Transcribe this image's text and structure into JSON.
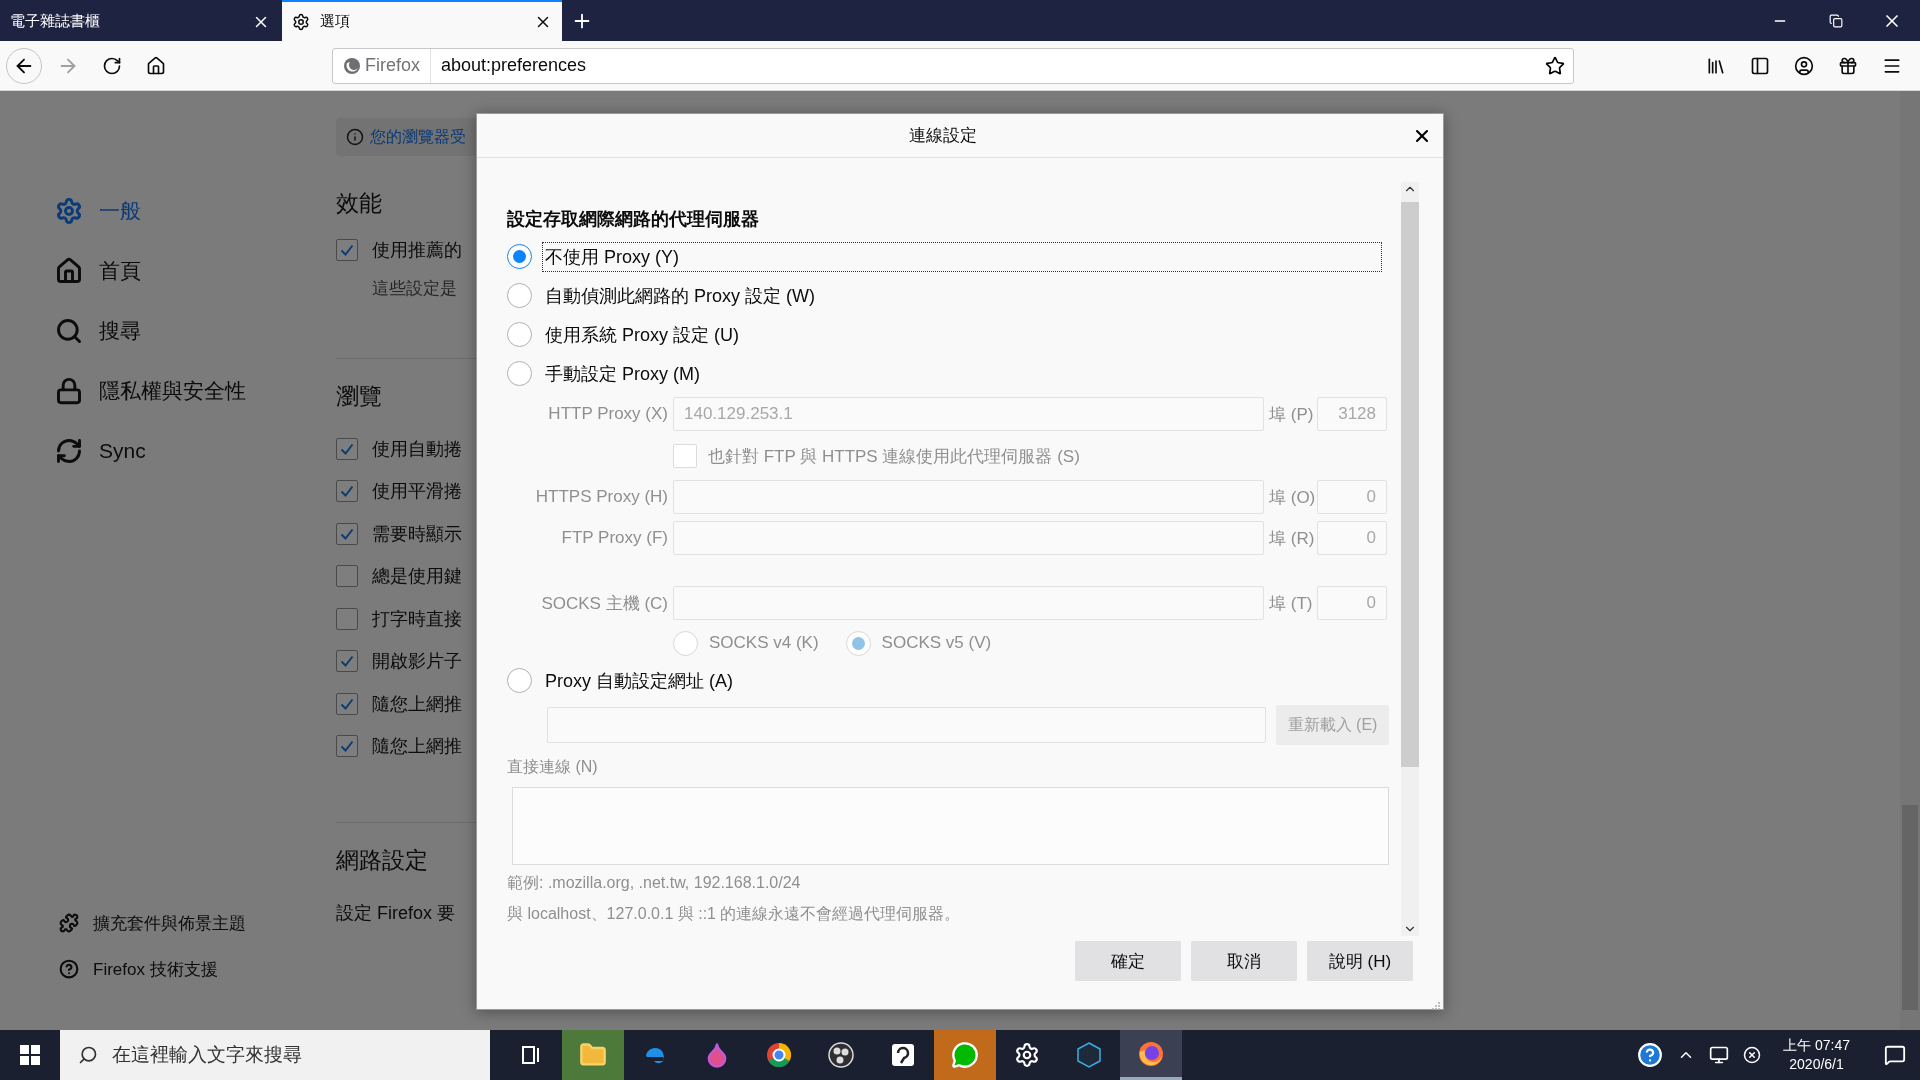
{
  "browser": {
    "tabs": [
      {
        "title": "電子雜誌書櫃",
        "selected": false
      },
      {
        "title": "選項",
        "selected": true
      }
    ],
    "url_bar": {
      "identity": "Firefox",
      "url": "about:preferences"
    }
  },
  "preferences": {
    "notice": "您的瀏覽器受",
    "sidebar": {
      "items": [
        {
          "label": "一般",
          "kind": "general",
          "selected": true
        },
        {
          "label": "首頁",
          "kind": "home",
          "selected": false
        },
        {
          "label": "搜尋",
          "kind": "search",
          "selected": false
        },
        {
          "label": "隱私權與安全性",
          "kind": "privacy",
          "selected": false
        },
        {
          "label": "Sync",
          "kind": "sync",
          "selected": false
        }
      ],
      "footer": [
        {
          "label": "擴充套件與佈景主題",
          "kind": "addons"
        },
        {
          "label": "Firefox 技術支援",
          "kind": "support"
        }
      ]
    },
    "sections": [
      {
        "title": "效能",
        "rows": [
          {
            "kind": "checkbox",
            "label": "使用推薦的",
            "checked": true
          },
          {
            "kind": "note",
            "label": "這些設定是"
          }
        ]
      },
      {
        "title": "瀏覽",
        "rows": [
          {
            "kind": "checkbox",
            "label": "使用自動捲",
            "checked": true
          },
          {
            "kind": "checkbox",
            "label": "使用平滑捲",
            "checked": true
          },
          {
            "kind": "checkbox",
            "label": "需要時顯示",
            "checked": true
          },
          {
            "kind": "checkbox",
            "label": "總是使用鍵",
            "checked": false
          },
          {
            "kind": "checkbox",
            "label": "打字時直接",
            "checked": false
          },
          {
            "kind": "checkbox",
            "label": "開啟影片子",
            "checked": true
          },
          {
            "kind": "checkbox",
            "label": "隨您上網推",
            "checked": true
          },
          {
            "kind": "checkbox",
            "label": "隨您上網推",
            "checked": true
          }
        ]
      },
      {
        "title": "網路設定",
        "rows": [
          {
            "kind": "text",
            "label": "設定 Firefox 要"
          }
        ]
      }
    ]
  },
  "dialog": {
    "title": "連線設定",
    "heading": "設定存取網際網路的代理伺服器",
    "modes": [
      {
        "kind": "none",
        "label": "不使用 Proxy (Y)",
        "selected": true,
        "focused": true
      },
      {
        "kind": "auto",
        "label": "自動偵測此網路的 Proxy 設定 (W)",
        "selected": false,
        "focused": false
      },
      {
        "kind": "system",
        "label": "使用系統 Proxy 設定 (U)",
        "selected": false,
        "focused": false
      },
      {
        "kind": "manual",
        "label": "手動設定 Proxy (M)",
        "selected": false,
        "focused": false
      },
      {
        "kind": "pac",
        "label": "Proxy 自動設定網址 (A)",
        "selected": false,
        "focused": false
      }
    ],
    "manual": {
      "disabled": true,
      "rows": [
        {
          "kind": "proxy",
          "label": "HTTP Proxy (X)",
          "value": "140.129.253.1",
          "port_label": "埠 (P)",
          "port": "3128"
        },
        {
          "kind": "checkbox",
          "label": "也針對 FTP 與 HTTPS 連線使用此代理伺服器 (S)",
          "checked": false
        },
        {
          "kind": "proxy",
          "label": "HTTPS Proxy (H)",
          "port_label": "埠 (O)",
          "port": "0"
        },
        {
          "kind": "proxy",
          "label": "FTP Proxy (F)",
          "port_label": "埠 (R)",
          "port": "0"
        },
        {
          "kind": "socks",
          "label": "SOCKS 主機 (C)",
          "port_label": "埠 (T)",
          "port": "0"
        }
      ],
      "socks_versions": [
        {
          "label": "SOCKS v4 (K)",
          "selected": false
        },
        {
          "label": "SOCKS v5 (V)",
          "selected": true
        }
      ]
    },
    "pac": {
      "disabled": true,
      "reload": "重新載入 (E)"
    },
    "no_proxy": {
      "disabled": true,
      "label": "直接連線 (N)",
      "example": "範例: .mozilla.org, .net.tw, 192.168.1.0/24",
      "note": "與 localhost、127.0.0.1 與 ::1 的連線永遠不會經過代理伺服器。"
    },
    "buttons": [
      {
        "label": "確定"
      },
      {
        "label": "取消"
      },
      {
        "label": "說明 (H)"
      }
    ]
  },
  "taskbar": {
    "search_placeholder": "在這裡輸入文字來搜尋",
    "apps": [
      {
        "kind": "taskview",
        "selected": false
      },
      {
        "kind": "files",
        "selected": false,
        "color": "#4d7a3a"
      },
      {
        "kind": "edge",
        "selected": false
      },
      {
        "kind": "drop",
        "selected": false
      },
      {
        "kind": "chrome",
        "selected": false
      },
      {
        "kind": "obs",
        "selected": false
      },
      {
        "kind": "note",
        "selected": false
      },
      {
        "kind": "line",
        "selected": false,
        "color": "#c26a1c"
      },
      {
        "kind": "settings",
        "selected": false
      },
      {
        "kind": "nox",
        "selected": false
      },
      {
        "kind": "firefox",
        "selected": true
      }
    ],
    "time": "上午 07:47",
    "date": "2020/6/1"
  }
}
